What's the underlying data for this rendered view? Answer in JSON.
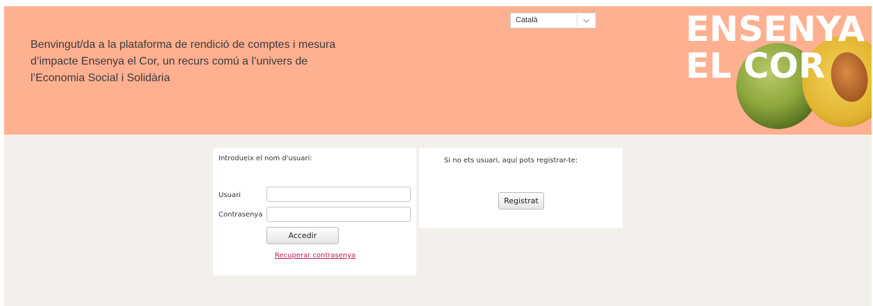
{
  "header": {
    "welcome_text": "Benvingut/da a la plataforma de rendició de comptes i mesura d’impacte Ensenya el Cor, un recurs comú a l’univers de l’Economia Social i Solidària",
    "background_color": "#ffb091",
    "language_select": {
      "selected": "Català",
      "icon": "chevron-down-icon"
    },
    "logo": {
      "line1": "ENSENYA",
      "line2": "EL COR"
    }
  },
  "login": {
    "intro": "Introdueix el nom d'usuari:",
    "username_label": "Usuari",
    "username_value": "",
    "password_label": "Contrasenya",
    "password_value": "",
    "submit_label": "Accedir",
    "recover_link": "Recuperar contrasenya",
    "link_color": "#c0185a"
  },
  "register": {
    "intro": "Si no ets usuari, aquí pots registrar-te:",
    "button_label": "Registrat"
  }
}
